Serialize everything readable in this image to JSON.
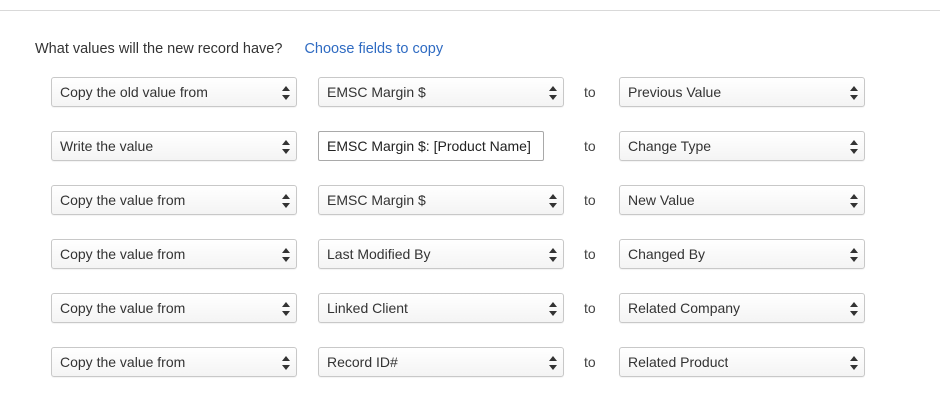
{
  "heading": {
    "question": "What values will the new record have?",
    "choose_link": "Choose fields to copy"
  },
  "rows": [
    {
      "action": "Copy the old value from",
      "source": "EMSC Margin $",
      "source_kind": "select",
      "to": "to",
      "target": "Previous Value"
    },
    {
      "action": "Write the value",
      "source": "EMSC Margin $: [Product Name]",
      "source_kind": "text",
      "to": "to",
      "target": "Change Type"
    },
    {
      "action": "Copy the value from",
      "source": "EMSC Margin $",
      "source_kind": "select",
      "to": "to",
      "target": "New Value"
    },
    {
      "action": "Copy the value from",
      "source": "Last Modified By",
      "source_kind": "select",
      "to": "to",
      "target": "Changed By"
    },
    {
      "action": "Copy the value from",
      "source": "Linked Client",
      "source_kind": "select",
      "to": "to",
      "target": "Related Company"
    },
    {
      "action": "Copy the value from",
      "source": "Record ID#",
      "source_kind": "select",
      "to": "to",
      "target": "Related Product"
    }
  ],
  "icons": {
    "select_arrows": "up-down-chevron-icon"
  },
  "colors": {
    "link": "#2f6bc2",
    "border": "#c8c8c8"
  }
}
